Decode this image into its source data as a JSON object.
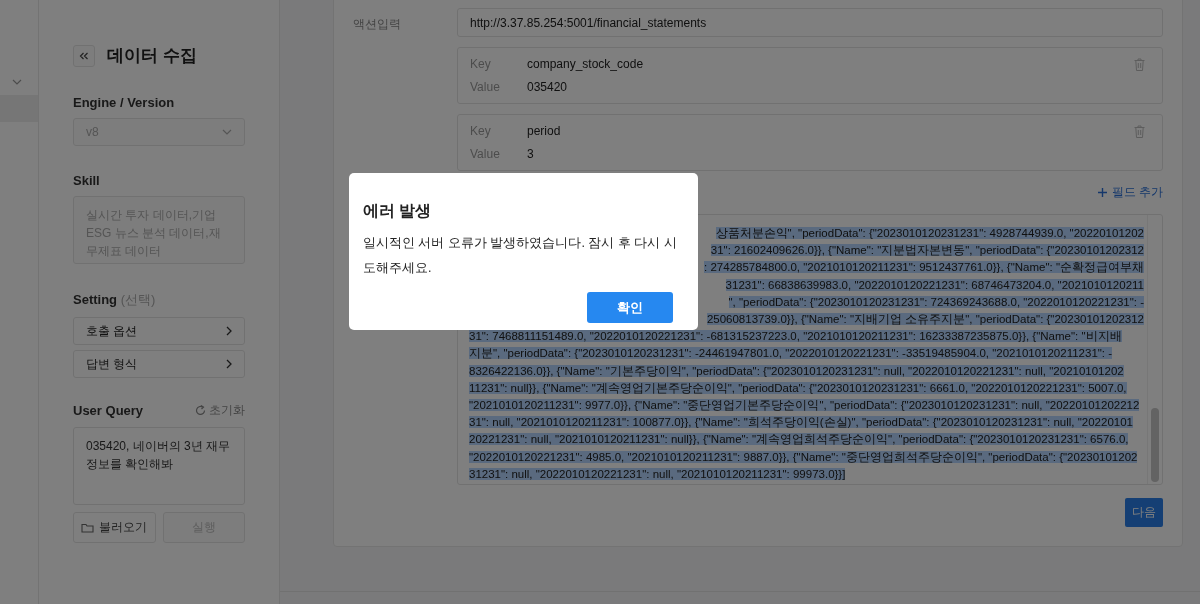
{
  "sidebar": {
    "title": "데이터 수집",
    "engine": {
      "label": "Engine / Version",
      "value": "v8",
      "disabled": true
    },
    "skill": {
      "label": "Skill",
      "value": "실시간 투자 데이터,기업 ESG 뉴스 분석 데이터,재무제표 데이터",
      "disabled": true
    },
    "setting": {
      "label": "Setting",
      "hint": "(선택)",
      "items": [
        "호출 옵션",
        "답변 형식"
      ]
    },
    "user_query": {
      "label": "User Query",
      "reset": "초기화",
      "value": "035420, 네이버의 3년 재무 정보를 확인해봐"
    },
    "buttons": [
      {
        "kind": "load",
        "label": "불러오기",
        "disabled": false
      },
      {
        "kind": "run",
        "label": "실행",
        "disabled": true
      }
    ]
  },
  "main": {
    "action_input": {
      "label": "액션입력",
      "value": "http://3.37.85.254:5001/financial_statements"
    },
    "params": [
      {
        "key_label": "Key",
        "key": "company_stock_code",
        "value_label": "Value",
        "value": "035420"
      },
      {
        "key_label": "Key",
        "key": "period",
        "value_label": "Value",
        "value": "3"
      }
    ],
    "add_field": "필드 추가",
    "result": {
      "selected": true,
      "fragments_beside_dialog": [
        "상품처분손익\", \"periodData\": {\"2023010120231231\": 4928744939.0, \"20220101202",
        "31\": 21602409626.0}}, {\"Name\": \"지분법자본변동\", \"periodData\": {\"20230101202312",
        ": 274285784800.0, \"2021010120211231\": 9512437761.0}}, {\"Name\": \"순확정급여부채",
        "31231\": 66838639983.0, \"2022010120221231\": 68746473204.0, \"2021010120211",
        "\", \"periodData\": {\"2023010120231231\": 724369243688.0, \"2022010120221231\": -",
        "25060813739.0}}, {\"Name\": \"지배기업 소유주지분\", \"periodData\": {\"20230101202312"
      ],
      "lines": [
        "31\": 7468811151489.0, \"2022010120221231\": -681315237223.0, \"2021010120211231\": 16233387235875.0}}, {\"Name\": \"비지배",
        "지분\", \"periodData\": {\"2023010120231231\": -24461947801.0, \"2022010120221231\": -33519485904.0, \"2021010120211231\": -",
        "8326422136.0}}, {\"Name\": \"기본주당이익\", \"periodData\": {\"2023010120231231\": null, \"2022010120221231\": null, \"20210101202",
        "11231\": null}}, {\"Name\": \"계속영업기본주당순이익\", \"periodData\": {\"2023010120231231\": 6661.0, \"2022010120221231\": 5007.0,",
        "\"2021010120211231\": 9977.0}}, {\"Name\": \"중단영업기본주당순이익\", \"periodData\": {\"2023010120231231\": null, \"20220101202212",
        "31\": null, \"2021010120211231\": 100877.0}}, {\"Name\": \"희석주당이익(손실)\", \"periodData\": {\"2023010120231231\": null, \"20220101",
        "20221231\": null, \"2021010120211231\": null}}, {\"Name\": \"계속영업희석주당순이익\", \"periodData\": {\"2023010120231231\": 6576.0,",
        "\"2022010120221231\": 4985.0, \"2021010120211231\": 9887.0}}, {\"Name\": \"중단영업희석주당순이익\", \"periodData\": {\"20230101202",
        "31231\": null, \"2022010120221231\": null, \"2021010120211231\": 99973.0}}]"
      ]
    },
    "next_button": "다음"
  },
  "dialog": {
    "title": "에러 발생",
    "message": "일시적인 서버 오류가 발생하였습니다. 잠시 후 다시 시도해주세요.",
    "confirm": "확인"
  }
}
